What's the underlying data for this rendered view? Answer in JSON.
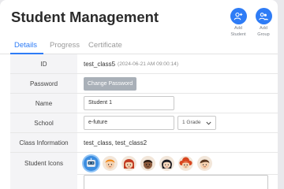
{
  "header": {
    "title": "Student Management"
  },
  "actions": {
    "add_student": {
      "label_line1": "Add",
      "label_line2": "Student",
      "icon": "add-user-icon"
    },
    "add_group": {
      "label_line1": "Add",
      "label_line2": "Group",
      "icon": "add-group-icon"
    }
  },
  "tabs": [
    {
      "label": "Details",
      "active": true
    },
    {
      "label": "Progress",
      "active": false
    },
    {
      "label": "Certificate",
      "active": false
    }
  ],
  "details": {
    "id": {
      "label": "ID",
      "value": "test_class5",
      "timestamp": "(2024-06-21 AM 09:00:14)"
    },
    "password": {
      "label": "Password",
      "button": "Change Password"
    },
    "name": {
      "label": "Name",
      "value": "Student 1"
    },
    "school": {
      "label": "School",
      "value": "e-future",
      "grade": "1 Grade"
    },
    "class_info": {
      "label": "Class Information",
      "value": "test_class, test_class2"
    },
    "student_icons": {
      "label": "Student Icons",
      "icons": [
        "robot-avatar-icon",
        "boy-orange-hair-icon",
        "girl-red-hair-icon",
        "boy-dark-skin-icon",
        "girl-black-hair-icon",
        "girl-red-curly-hair-icon",
        "boy-brown-hair-icon"
      ]
    }
  },
  "colors": {
    "accent": "#2e7cf6",
    "label_bg": "#f4f4f6",
    "button_gray": "#a9b0b8"
  }
}
